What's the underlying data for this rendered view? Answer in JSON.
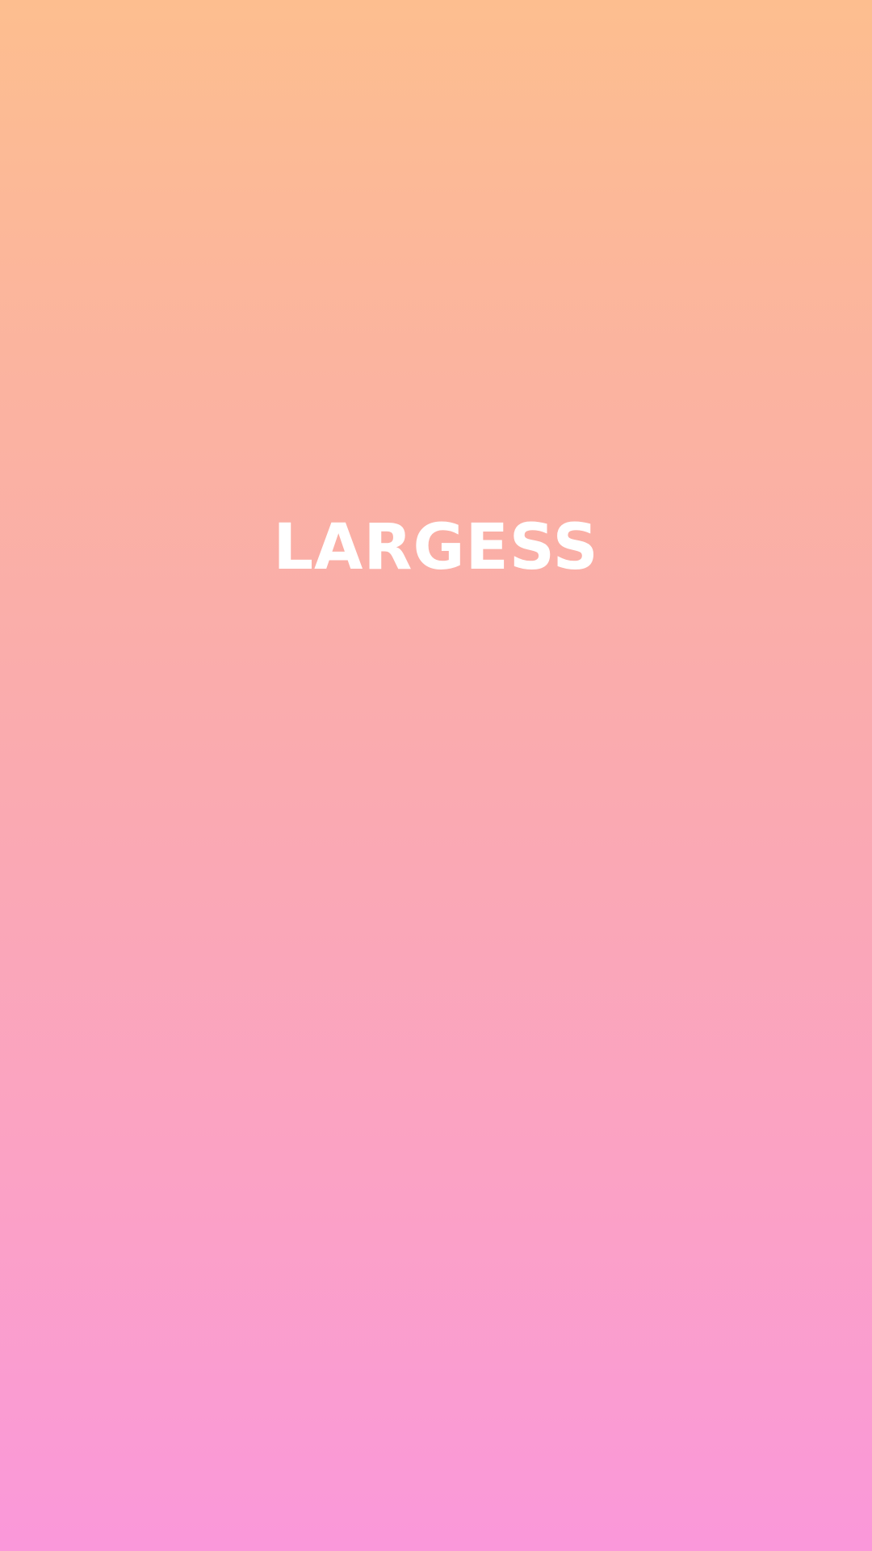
{
  "splash": {
    "app_name": "LARGESS"
  },
  "colors": {
    "gradient_top": "#FDBE8F",
    "gradient_bottom": "#FA98DA",
    "logo_text": "#FFFFFF"
  }
}
